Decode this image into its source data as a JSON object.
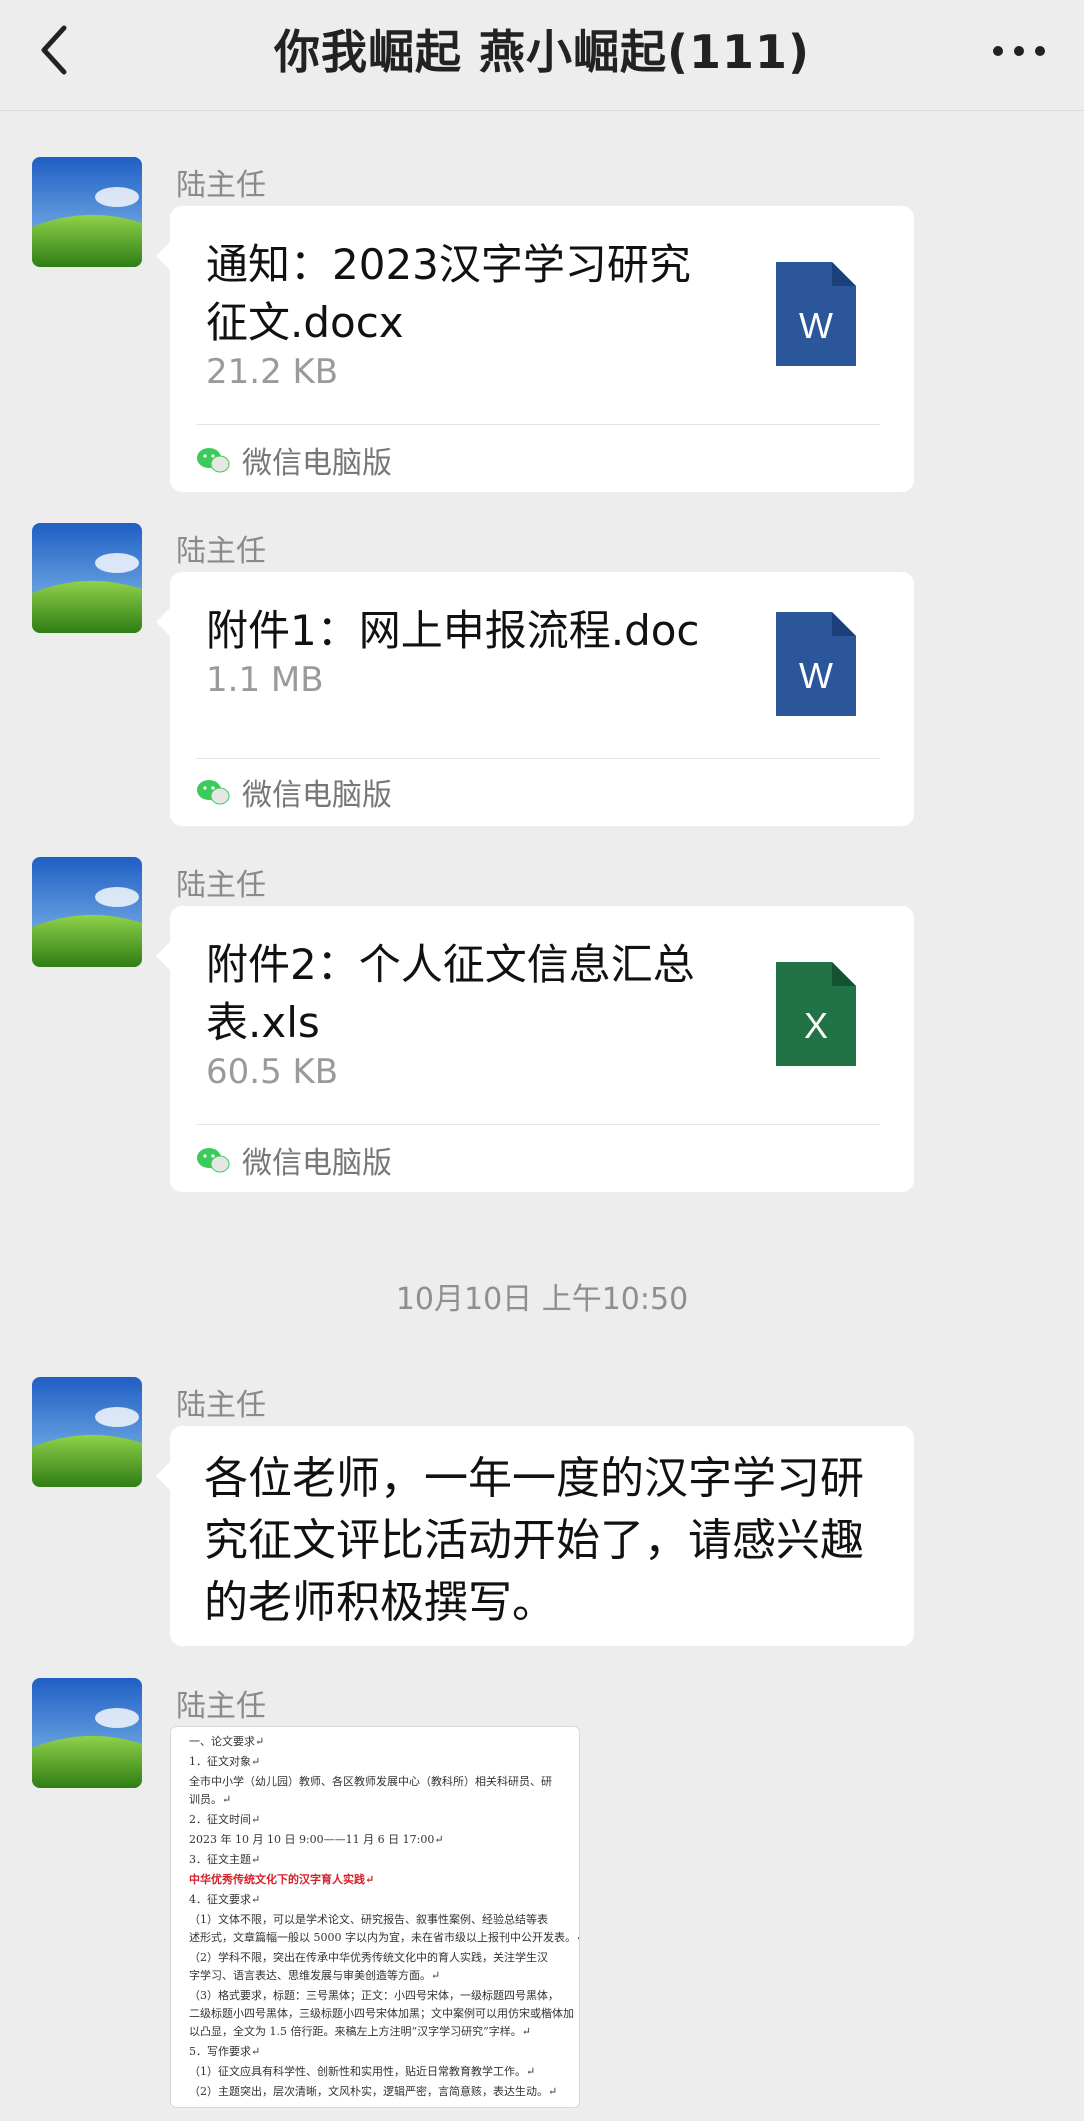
{
  "header": {
    "title": "你我崛起 燕小崛起(111)"
  },
  "messages": [
    {
      "sender": "陆主任",
      "type": "file",
      "file_name": "通知：2023汉字学习研究征文.docx",
      "file_size": "21.2 KB",
      "file_icon": "word-icon",
      "icon_letter": "W",
      "source": "微信电脑版"
    },
    {
      "sender": "陆主任",
      "type": "file",
      "file_name": "附件1：网上申报流程.doc",
      "file_size": "1.1 MB",
      "file_icon": "word-icon",
      "icon_letter": "W",
      "source": "微信电脑版"
    },
    {
      "sender": "陆主任",
      "type": "file",
      "file_name": "附件2：个人征文信息汇总表.xls",
      "file_size": "60.5 KB",
      "file_icon": "excel-icon",
      "icon_letter": "X",
      "source": "微信电脑版"
    },
    {
      "sender": "陆主任",
      "type": "text",
      "text": "各位老师，一年一度的汉字学习研究征文评比活动开始了，请感兴趣的老师积极撰写。"
    },
    {
      "sender": "陆主任",
      "type": "image",
      "doc_lines": [
        "一、论文要求↵",
        "1．征文对象↵",
        "全市中小学（幼儿园）教师、各区教师发展中心（教科所）相关科研员、研",
        "训员。↵",
        "2．征文时间↵",
        "2023 年 10 月 10 日 9:00——11 月 6 日 17:00↵",
        "3．征文主题↵",
        "中华优秀传统文化下的汉字育人实践↵",
        "4．征文要求↵",
        "（1）文体不限，可以是学术论文、研究报告、叙事性案例、经验总结等表",
        "述形式，文章篇幅一般以 5000 字以内为宜，未在省市级以上报刊中公开发表。↵",
        "（2）学科不限，突出在传承中华优秀传统文化中的育人实践，关注学生汉",
        "字学习、语言表达、思维发展与审美创造等方面。↵",
        "（3）格式要求，标题：三号黑体；正文：小四号宋体，一级标题四号黑体，",
        "二级标题小四号黑体，三级标题小四号宋体加黑；文中案例可以用仿宋或楷体加",
        "以凸显，全文为 1.5 倍行距。来稿左上方注明“汉字学习研究”字样。↵",
        "5．写作要求↵",
        "（1）征文应具有科学性、创新性和实用性，贴近日常教育教学工作。↵",
        "（2）主题突出，层次清晰，文风朴实，逻辑严密，言简意赅，表达生动。↵"
      ]
    }
  ],
  "timestamp": "10月10日 上午10:50",
  "colors": {
    "word": "#2b579a",
    "excel": "#217346",
    "background": "#ededed",
    "bubble": "#ffffff",
    "wechat_green": "#3ccb5b"
  }
}
